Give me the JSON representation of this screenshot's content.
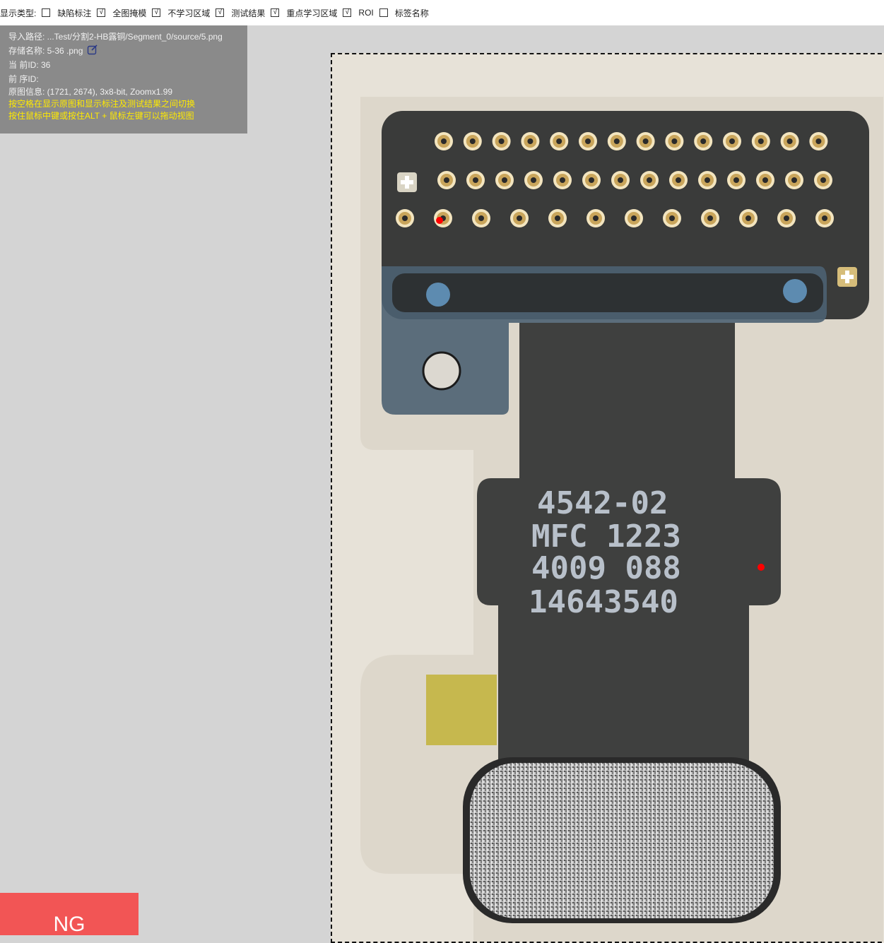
{
  "toolbar": {
    "label": "显示类型:",
    "options": [
      {
        "label": "缺陷标注",
        "checked": false
      },
      {
        "label": "全图掩模",
        "checked": true
      },
      {
        "label": "不学习区域",
        "checked": true
      },
      {
        "label": "测试结果",
        "checked": true
      },
      {
        "label": "重点学习区域",
        "checked": true
      },
      {
        "label": "ROI",
        "checked": true
      },
      {
        "label": "标签名称",
        "checked": false
      }
    ]
  },
  "info": {
    "import_path": "导入路径: ...Test/分割2-HB露铜/Segment_0/source/5.png",
    "save_name": "存储名称: 5-36 .png",
    "current_id": "当 前ID: 36",
    "prev_id": "前 序ID:",
    "image_info": "原图信息: (1721, 2674), 3x8-bit, Zoomx1.99",
    "hint_1": "按空格在显示原图和显示标注及测试结果之间切换",
    "hint_2": "按住鼠标中键或按住ALT + 鼠标左键可以拖动视图"
  },
  "image": {
    "markings": [
      "4542-02",
      "MFC 1223",
      "4009 088",
      "14643540"
    ],
    "defect_color": "#ff0000",
    "board_color": "#3c3d3c",
    "pad_color": "#d8b56a"
  },
  "result": {
    "label": "NG",
    "color": "#f25555"
  }
}
